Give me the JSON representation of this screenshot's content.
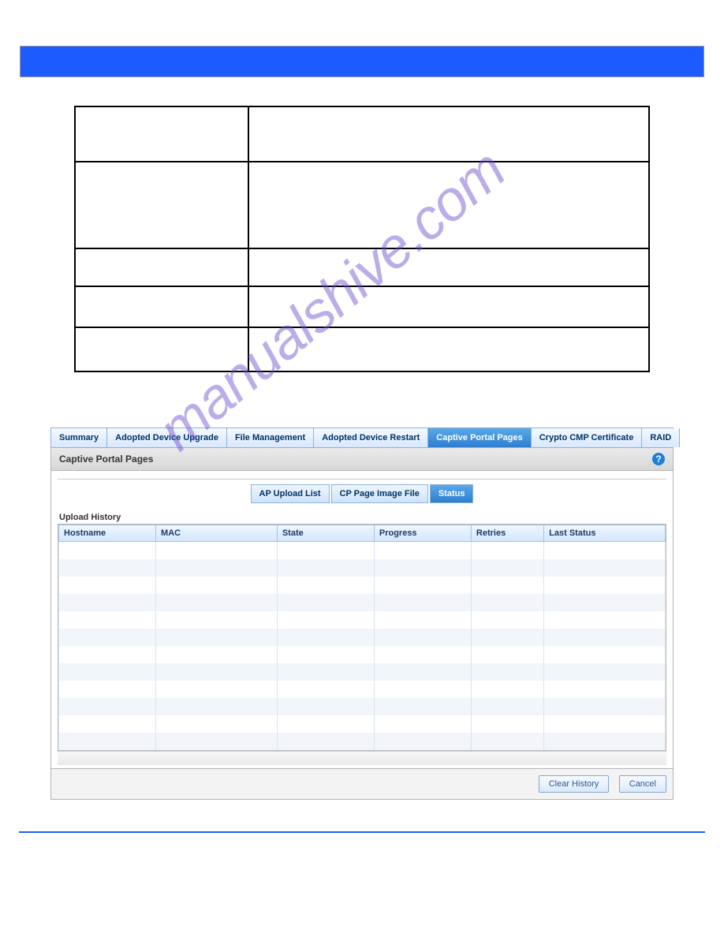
{
  "watermark_text": "manualshive.com",
  "main_tabs": [
    {
      "label": "Summary",
      "active": false
    },
    {
      "label": "Adopted Device Upgrade",
      "active": false
    },
    {
      "label": "File Management",
      "active": false
    },
    {
      "label": "Adopted Device Restart",
      "active": false
    },
    {
      "label": "Captive Portal Pages",
      "active": true
    },
    {
      "label": "Crypto CMP Certificate",
      "active": false
    },
    {
      "label": "RAID",
      "active": false
    }
  ],
  "panel_title": "Captive Portal Pages",
  "help_icon_char": "?",
  "sub_tabs": [
    {
      "label": "AP Upload List",
      "active": false
    },
    {
      "label": "CP Page Image File",
      "active": false
    },
    {
      "label": "Status",
      "active": true
    }
  ],
  "fieldset_legend": "Upload History",
  "columns": [
    "Hostname",
    "MAC",
    "State",
    "Progress",
    "Retries",
    "Last Status"
  ],
  "row_count": 12,
  "buttons": {
    "clear": "Clear History",
    "cancel": "Cancel"
  }
}
